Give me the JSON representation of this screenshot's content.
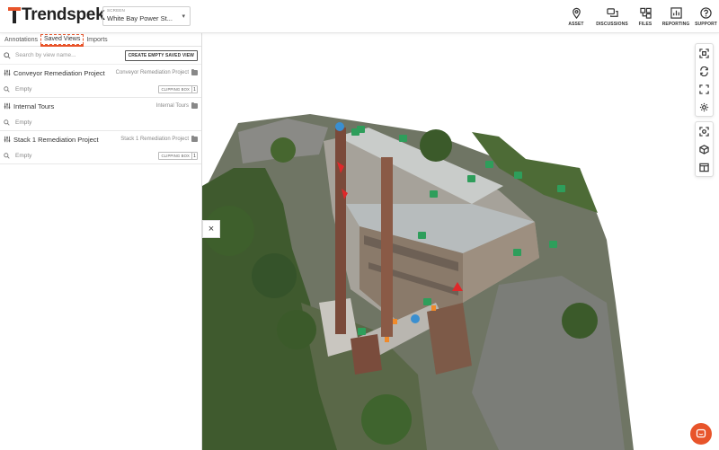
{
  "header": {
    "logo_text": "Trendspek",
    "asset_caption": "SCREEN",
    "asset_value": "White Bay Power St...",
    "nav": [
      {
        "label": "ASSET",
        "icon": "location-pin-icon"
      },
      {
        "label": "DISCUSSIONS",
        "icon": "chat-bubbles-icon"
      },
      {
        "label": "FILES",
        "icon": "files-icon"
      },
      {
        "label": "REPORTING",
        "icon": "reporting-icon"
      },
      {
        "label": "SUPPORT",
        "icon": "help-icon"
      }
    ]
  },
  "sidebar": {
    "tabs": [
      {
        "label": "Annotations",
        "active": false
      },
      {
        "label": "Saved Views",
        "active": true
      },
      {
        "label": "Imports",
        "active": false
      }
    ],
    "search_placeholder": "Search by view name...",
    "create_button": "CREATE EMPTY SAVED VIEW",
    "views": [
      {
        "name": "Conveyor Remediation Project",
        "group": "Conveyor Remediation Project",
        "status": "Empty",
        "badge_label": "CLIPPING BOX",
        "badge_count": "1"
      },
      {
        "name": "Internal Tours",
        "group": "Internal Tours",
        "status": "Empty",
        "badge_label": "",
        "badge_count": ""
      },
      {
        "name": "Stack 1 Remediation Project",
        "group": "Stack 1 Remediation Project",
        "status": "Empty",
        "badge_label": "CLIPPING BOX",
        "badge_count": "1"
      }
    ]
  },
  "viewer": {
    "close_symbol": "×",
    "tools_top": [
      "screenshot-icon",
      "sync-icon",
      "fullscreen-icon",
      "settings-icon"
    ],
    "tools_bottom": [
      "focus-icon",
      "cube-icon",
      "split-view-icon"
    ]
  },
  "colors": {
    "accent": "#e8542a",
    "marker_green": "#2e9e5b"
  }
}
